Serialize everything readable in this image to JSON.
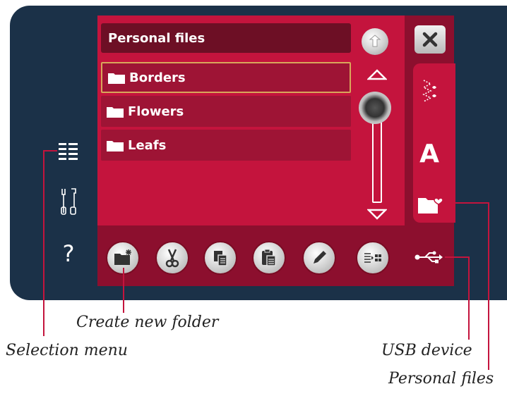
{
  "header": {
    "title": "Personal files"
  },
  "file_list": [
    {
      "name": "Borders",
      "type": "folder",
      "selected": true
    },
    {
      "name": "Flowers",
      "type": "folder",
      "selected": false
    },
    {
      "name": "Leafs",
      "type": "folder",
      "selected": false
    }
  ],
  "left_menu": [
    {
      "name": "selection-menu",
      "icon": "list-icon"
    },
    {
      "name": "tools",
      "icon": "tools-icon"
    },
    {
      "name": "help",
      "icon": "question-icon",
      "glyph": "?"
    }
  ],
  "right_tabs": [
    {
      "name": "close",
      "icon": "close-icon"
    },
    {
      "name": "stitches",
      "icon": "stitch-icon"
    },
    {
      "name": "fonts",
      "icon": "font-icon",
      "glyph": "A"
    },
    {
      "name": "personal-files",
      "icon": "folder-heart-icon"
    },
    {
      "name": "usb-device",
      "icon": "usb-icon"
    }
  ],
  "toolbar": [
    {
      "name": "create-new-folder",
      "icon": "new-folder-icon"
    },
    {
      "name": "cut",
      "icon": "scissors-icon"
    },
    {
      "name": "copy",
      "icon": "copy-icon"
    },
    {
      "name": "paste",
      "icon": "paste-icon"
    },
    {
      "name": "rename",
      "icon": "pencil-icon"
    },
    {
      "name": "view-toggle",
      "icon": "list-grid-icon"
    }
  ],
  "callouts": {
    "create_new_folder": "Create new folder",
    "selection_menu": "Selection menu",
    "usb_device": "USB device",
    "personal_files": "Personal files"
  },
  "colors": {
    "panel": "#c4143d",
    "dark_panel": "#8c0f2e",
    "bezel": "#1b3148",
    "selection_border": "#d8a75a"
  }
}
